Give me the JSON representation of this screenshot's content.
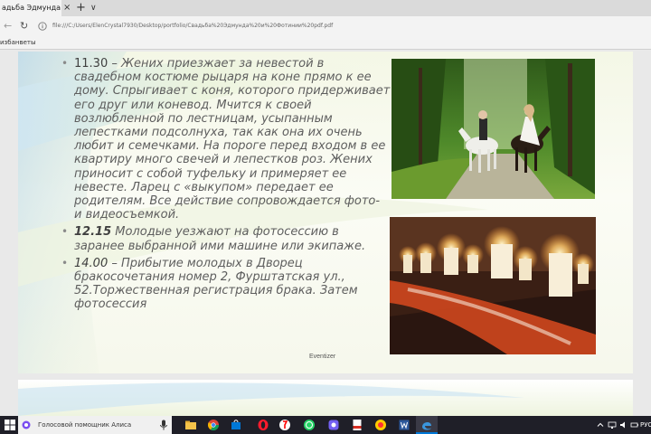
{
  "browser": {
    "tab_title": "адьба Эдмунда и Фє",
    "tab_close": "×",
    "tab_new": "+",
    "tab_list": "∨",
    "url": "file:///C:/Users/ElenCrystal7930/Desktop/portfolio/Свадьба%20Эдмунда%20и%20Фотинии%20pdf.pdf",
    "favorites_label": "избанветы",
    "back_icon": "arrow-left-icon",
    "refresh_icon": "refresh-icon"
  },
  "slide": {
    "items": [
      {
        "time": "11.30",
        "text": " – Жених приезжает за невестой в свадебном костюме рыцаря на коне прямо к ее дому. Спрыгивает с коня, которого придерживает его друг или коневод. Мчится к своей возлюбленной по лестницам, усыпанным лепестками подсолнуха, так как она их очень любит и семечками. На пороге перед входом в ее квартиру много свечей и лепестков роз. Жених приносит с собой туфельку и примеряет ее невесте. Ларец с «выкупом» передает ее родителям. Все действие сопровождается фото- и видеосъемкой."
      },
      {
        "time": "12.15",
        "text": " Молодые уезжают на фотосессию в заранее выбранной ими машине или экипаже."
      },
      {
        "time": "14.00",
        "text": " – Прибытие молодых в Дворец бракосочетания номер 2, Фурштатская ул., 52.Торжественная регистрация брака. Затем фотосессия"
      }
    ],
    "footer": "Eventizer",
    "photo_1": "couple-on-horses-photo",
    "photo_2": "candles-and-rose-petals-photo"
  },
  "taskbar": {
    "assistant_label": "Голосовой помощник Алиса",
    "language": "РУС",
    "icons": [
      "windows-icon",
      "alice-icon",
      "microphone-icon",
      "file-explorer-icon",
      "chrome-icon",
      "store-icon",
      "opera-icon",
      "yandex-icon",
      "whatsapp-icon",
      "viber-icon",
      "pdf-icon",
      "word-icon",
      "edge-icon"
    ],
    "colors": {
      "taskbar": "#1f1f28",
      "accent": "#0078d7"
    }
  }
}
